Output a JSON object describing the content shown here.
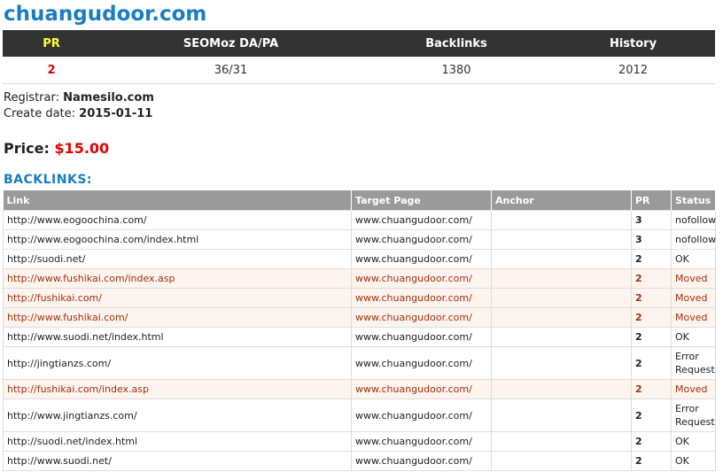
{
  "domain": "chuangudoor.com",
  "summary": {
    "headers": {
      "pr": "PR",
      "seomoz": "SEOMoz DA/PA",
      "backlinks": "Backlinks",
      "history": "History"
    },
    "values": {
      "pr": "2",
      "seomoz": "36/31",
      "backlinks": "1380",
      "history": "2012"
    }
  },
  "registrar": {
    "label": "Registrar:",
    "value": "Namesilo.com"
  },
  "create_date": {
    "label": "Create date:",
    "value": "2015-01-11"
  },
  "price": {
    "label": "Price:",
    "value": "$15.00"
  },
  "backlinks_heading": "BACKLINKS:",
  "backlinks_table": {
    "headers": {
      "link": "Link",
      "target": "Target Page",
      "anchor": "Anchor",
      "pr": "PR",
      "status": "Status"
    },
    "rows": [
      {
        "link": "http://www.eogoochina.com/",
        "target": "www.chuangudoor.com/",
        "anchor": "",
        "pr": "3",
        "status": "nofollow"
      },
      {
        "link": "http://www.eogoochina.com/index.html",
        "target": "www.chuangudoor.com/",
        "anchor": "",
        "pr": "3",
        "status": "nofollow"
      },
      {
        "link": "http://suodi.net/",
        "target": "www.chuangudoor.com/",
        "anchor": "",
        "pr": "2",
        "status": "OK"
      },
      {
        "link": "http://www.fushikai.com/index.asp",
        "target": "www.chuangudoor.com/",
        "anchor": "",
        "pr": "2",
        "status": "Moved"
      },
      {
        "link": "http://fushikai.com/",
        "target": "www.chuangudoor.com/",
        "anchor": "",
        "pr": "2",
        "status": "Moved"
      },
      {
        "link": "http://www.fushikai.com/",
        "target": "www.chuangudoor.com/",
        "anchor": "",
        "pr": "2",
        "status": "Moved"
      },
      {
        "link": "http://www.suodi.net/index.html",
        "target": "www.chuangudoor.com/",
        "anchor": "",
        "pr": "2",
        "status": "OK"
      },
      {
        "link": "http://jingtianzs.com/",
        "target": "www.chuangudoor.com/",
        "anchor": "",
        "pr": "2",
        "status": "Error Request"
      },
      {
        "link": "http://fushikai.com/index.asp",
        "target": "www.chuangudoor.com/",
        "anchor": "",
        "pr": "2",
        "status": "Moved"
      },
      {
        "link": "http://www.jingtianzs.com/",
        "target": "www.chuangudoor.com/",
        "anchor": "",
        "pr": "2",
        "status": "Error Request"
      },
      {
        "link": "http://suodi.net/index.html",
        "target": "www.chuangudoor.com/",
        "anchor": "",
        "pr": "2",
        "status": "OK"
      },
      {
        "link": "http://www.suodi.net/",
        "target": "www.chuangudoor.com/",
        "anchor": "",
        "pr": "2",
        "status": "OK"
      }
    ]
  },
  "colors": {
    "title": "#1a7dc1",
    "price": "#e60000",
    "moved_text": "#a0320e",
    "moved_bg": "#fdf3ef"
  }
}
